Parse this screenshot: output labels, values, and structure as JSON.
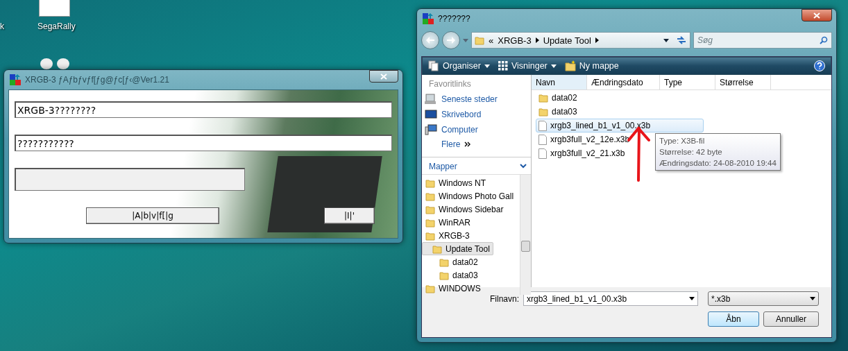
{
  "desktop": {
    "icons": [
      {
        "label": "k"
      },
      {
        "label": "SegaRally"
      }
    ]
  },
  "updater_window": {
    "title": "XRGB-3 ƒAƒbƒvƒf[ƒg@ƒc[ƒ‹@Ver1.21",
    "fields": [
      {
        "value": "XRGB-3????????"
      },
      {
        "value": "???????????"
      }
    ],
    "progress": {
      "level": 0
    },
    "buttons": [
      "|A|b|v|f[|g",
      "|I|'"
    ]
  },
  "open_dialog": {
    "title": "???????",
    "breadcrumb_prefix": "«",
    "breadcrumb": [
      "XRGB-3",
      "Update Tool"
    ],
    "search": {
      "placeholder": "Søg"
    },
    "toolbar": [
      {
        "label": "Organiser",
        "kind": "organise"
      },
      {
        "label": "Visninger",
        "kind": "views"
      },
      {
        "label": "Ny mappe",
        "kind": "newfolder"
      }
    ],
    "favorites_heading": "Favoritlinks",
    "favorites": [
      {
        "label": "Seneste steder",
        "kind": "recent"
      },
      {
        "label": "Skrivebord",
        "kind": "desktop"
      },
      {
        "label": "Computer",
        "kind": "computer"
      }
    ],
    "more": "Flere",
    "folders_heading": "Mapper",
    "tree": [
      {
        "label": "Windows NT",
        "selected": false
      },
      {
        "label": "Windows Photo Gall",
        "selected": false
      },
      {
        "label": "Windows Sidebar",
        "selected": false
      },
      {
        "label": "WinRAR",
        "selected": false
      },
      {
        "label": "XRGB-3",
        "selected": false,
        "children": [
          {
            "label": "Update Tool",
            "selected": true,
            "children": [
              {
                "label": "data02",
                "selected": false
              },
              {
                "label": "data03",
                "selected": false
              }
            ]
          }
        ]
      },
      {
        "label": "WINDOWS",
        "selected": false
      }
    ],
    "columns": [
      "Navn",
      "Ændringsdato",
      "Type",
      "Størrelse"
    ],
    "files": [
      {
        "name": "data02",
        "kind": "folder",
        "selected": false
      },
      {
        "name": "data03",
        "kind": "folder",
        "selected": false
      },
      {
        "name": "xrgb3_lined_b1_v1_00.x3b",
        "kind": "file",
        "selected": true
      },
      {
        "name": "xrgb3full_v2_12e.x3b",
        "kind": "file",
        "selected": false
      },
      {
        "name": "xrgb3full_v2_21.x3b",
        "kind": "file",
        "selected": false
      }
    ],
    "tooltip": [
      "Type: X3B-fil",
      "Størrelse: 42 byte",
      "Ændringsdato: 24-08-2010 19:44"
    ],
    "filename_label": "Filnavn:",
    "filename": "xrgb3_lined_b1_v1_00.x3b",
    "filter": "*.x3b",
    "buttons": [
      "Åbn",
      "Annuller"
    ]
  }
}
